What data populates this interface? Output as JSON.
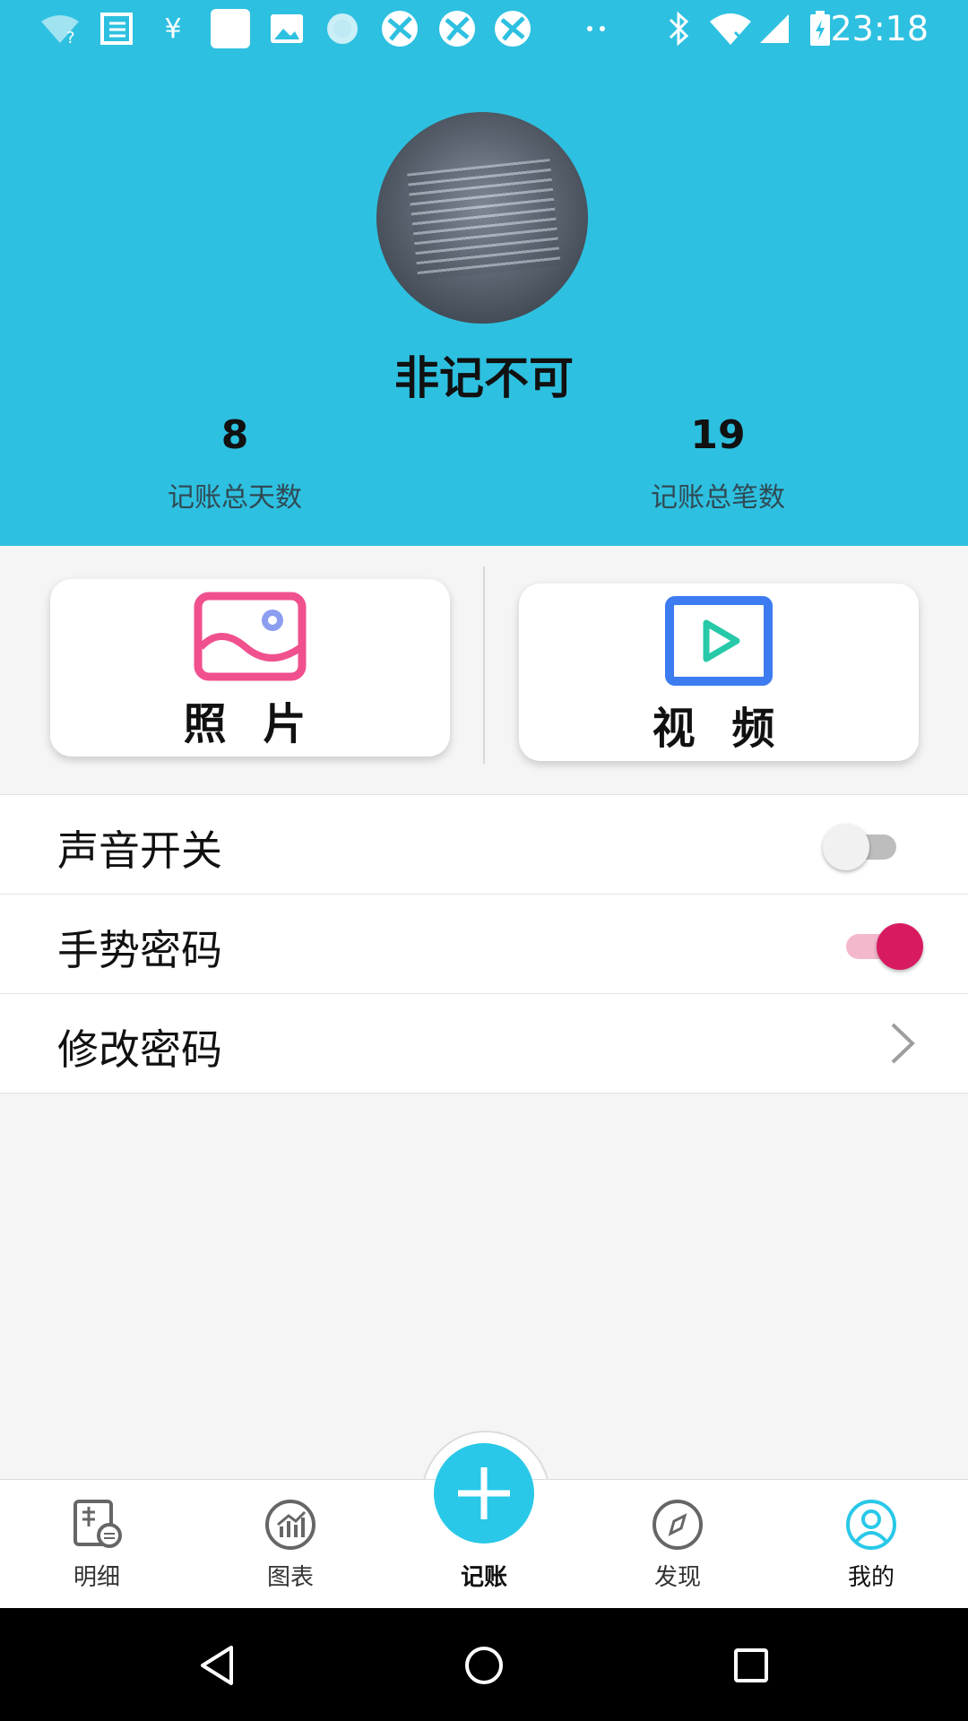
{
  "status_bar": {
    "time": "23:18",
    "left_icons": [
      "wifi-question-icon",
      "news-icon",
      "yen-icon",
      "blank-app-icon",
      "image-icon",
      "loading-icon",
      "app-icon",
      "app-icon",
      "app-icon",
      "more-dots-icon"
    ],
    "right_icons": [
      "bluetooth-icon",
      "wifi-off-icon",
      "signal-icon",
      "battery-charging-icon"
    ]
  },
  "profile": {
    "username": "非记不可",
    "stats": [
      {
        "value": "8",
        "label": "记账总天数"
      },
      {
        "value": "19",
        "label": "记账总笔数"
      }
    ]
  },
  "media": {
    "photo_label": "照 片",
    "video_label": "视 频"
  },
  "settings": {
    "sound_label": "声音开关",
    "sound_on": false,
    "gesture_label": "手势密码",
    "gesture_on": true,
    "change_password_label": "修改密码"
  },
  "bottom_nav": {
    "items": [
      {
        "label": "明细"
      },
      {
        "label": "图表"
      },
      {
        "label": "记账"
      },
      {
        "label": "发现"
      },
      {
        "label": "我的"
      }
    ],
    "active_index": 4
  },
  "colors": {
    "header_bg": "#2ec0e0",
    "fab": "#29c8e8",
    "accent_pink": "#e0336e",
    "active_nav": "#29c8e8",
    "photo_icon": "#f0508e",
    "video_icon": "#3d7cf0"
  }
}
